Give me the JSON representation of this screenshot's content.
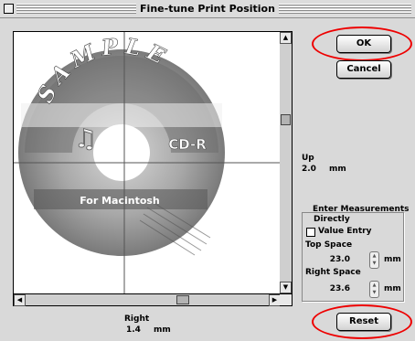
{
  "window": {
    "title": "Fine-tune Print Position"
  },
  "disc": {
    "sample_text": "SAMPLE",
    "label_right": "CD-R",
    "label_bottom": "For Macintosh"
  },
  "buttons": {
    "ok": "OK",
    "cancel": "Cancel",
    "reset": "Reset"
  },
  "up": {
    "label": "Up",
    "value": "2.0",
    "unit": "mm"
  },
  "right": {
    "label": "Right",
    "value": "1.4",
    "unit": "mm"
  },
  "measurements": {
    "heading_line1": "Enter Measurements",
    "heading_line2": "Directly",
    "value_entry": "Value Entry",
    "value_entry_checked": false,
    "top_space_label": "Top Space",
    "top_space_value": "23.0",
    "top_space_unit": "mm",
    "right_space_label": "Right Space",
    "right_space_value": "23.6",
    "right_space_unit": "mm"
  }
}
